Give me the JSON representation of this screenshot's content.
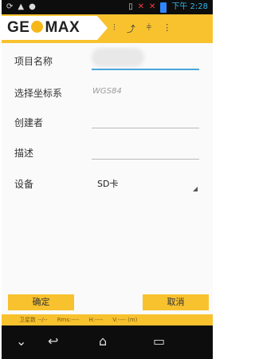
{
  "status_bar": {
    "left_icons": [
      "sync-icon",
      "warning-icon",
      "chat-icon"
    ],
    "right_icons": [
      "vibrate-icon",
      "no-sim-icon",
      "no-signal-icon",
      "battery-icon"
    ],
    "time": "下午 2:28"
  },
  "app_bar": {
    "logo_left": "GE",
    "logo_right": "MAX",
    "toolbar_icons": [
      "tool-1-icon",
      "tool-2-icon",
      "tool-3-icon",
      "tool-4-icon"
    ]
  },
  "form": {
    "project_name_label": "项目名称",
    "coord_system_label": "选择坐标系",
    "coord_system_value": "WGS84",
    "creator_label": "创建者",
    "description_label": "描述",
    "device_label": "设备",
    "device_value": "SD卡"
  },
  "buttons": {
    "ok": "确定",
    "cancel": "取消"
  },
  "status_strip": {
    "sats": "卫星数 --/--",
    "rms": "Rms:----",
    "h": "H:----",
    "v": "V:---- (m)"
  },
  "colors": {
    "accent": "#F8C22F",
    "statusbar": "#0D0D0D",
    "focus_line": "#4AA8D8"
  }
}
